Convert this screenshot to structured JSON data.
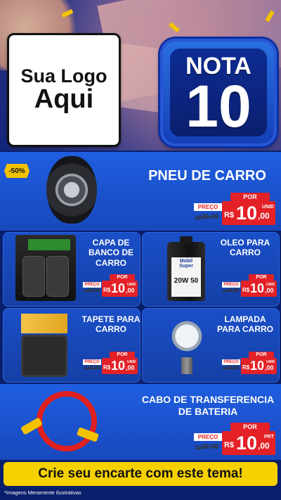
{
  "header": {
    "logo_line1": "Sua Logo",
    "logo_line2": "Aqui",
    "badge_word": "NOTA",
    "badge_number": "10"
  },
  "featured": {
    "discount_badge": "-50%",
    "title": "PNEU DE CARRO",
    "por_label": "POR",
    "preco_label": "PREÇO",
    "old_price": "20,00",
    "currency": "R$",
    "price_int": "10",
    "price_dec": ",00",
    "unit": "UNID"
  },
  "products": [
    {
      "title": "CAPA DE BANCO DE CARRO",
      "por_label": "POR",
      "preco_label": "PREÇO",
      "old_price": "20,00",
      "currency": "R$",
      "price_int": "10",
      "price_dec": ",00",
      "unit": "UNID"
    },
    {
      "title": "OLEO PARA CARRO",
      "por_label": "POR",
      "preco_label": "PREÇO",
      "old_price": "20,00",
      "currency": "R$",
      "price_int": "10",
      "price_dec": ",00",
      "unit": "UNID",
      "brand": "Mobil Super",
      "viscosity": "20W 50"
    },
    {
      "title": "TAPETE PARA CARRO",
      "por_label": "POR",
      "preco_label": "PREÇO",
      "old_price": "20,00",
      "currency": "R$",
      "price_int": "10",
      "price_dec": ",00",
      "unit": "UNID"
    },
    {
      "title": "LAMPADA PARA CARRO",
      "por_label": "POR",
      "preco_label": "PREÇO",
      "old_price": "20,00",
      "currency": "R$",
      "price_int": "10",
      "price_dec": ",00",
      "unit": "UNID"
    }
  ],
  "bottom": {
    "title": "CABO DE TRANSFERENCIA DE BATERIA",
    "por_label": "POR",
    "preco_label": "PREÇO",
    "old_price": "20,00",
    "currency": "R$",
    "price_int": "10",
    "price_dec": ",00",
    "unit": "PRT"
  },
  "cta": "Crie seu encarte com este tema!",
  "footnote": "*Imagens Meramente Ilustrativas",
  "colors": {
    "primary_blue": "#1d57d6",
    "dark_blue": "#0a1f6b",
    "price_red": "#e32127",
    "accent_yellow": "#f5d100"
  }
}
